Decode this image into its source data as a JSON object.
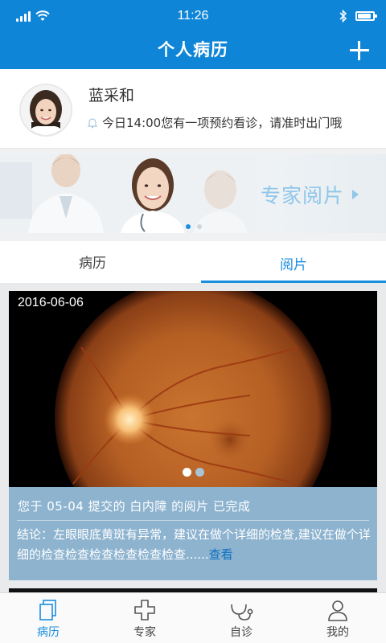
{
  "status_bar": {
    "time": "11:26",
    "battery_level": 0.9
  },
  "nav": {
    "title": "个人病历"
  },
  "profile": {
    "name": "蓝采和",
    "notice": "今日14:00您有一项预约看诊，请准时出门哦"
  },
  "banner": {
    "text": "专家阅片",
    "slide_count": 2,
    "active_slide": 1
  },
  "tabs": [
    {
      "label": "病历",
      "active": false
    },
    {
      "label": "阅片",
      "active": true
    }
  ],
  "record": {
    "date": "2016-06-06",
    "image_count": 2,
    "active_image": 1,
    "status": "您于 05-04 提交的 白内障 的阅片 已完成",
    "conclusion": "结论：左眼眼底黄斑有异常，建议在做个详细的检查,建议在做个详细的检查检查检查检查检查检查......",
    "view_label": "查看"
  },
  "tabbar": [
    {
      "label": "病历",
      "icon": "medical-record-icon",
      "active": true
    },
    {
      "label": "专家",
      "icon": "medical-cross-icon",
      "active": false
    },
    {
      "label": "自诊",
      "icon": "stethoscope-icon",
      "active": false
    },
    {
      "label": "我的",
      "icon": "user-icon",
      "active": false
    }
  ],
  "colors": {
    "primary": "#0f85d8",
    "accent": "#1a8ede",
    "card_info_bg": "#8db3cf",
    "banner_text": "#8fc6ea"
  }
}
